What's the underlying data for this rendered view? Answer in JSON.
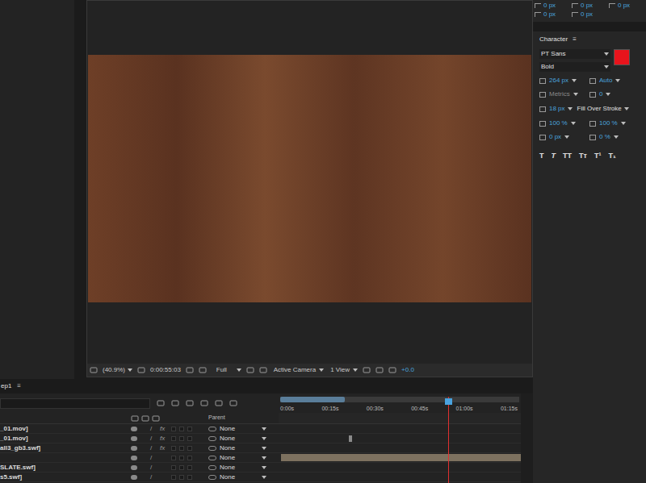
{
  "viewer": {
    "zoom": "(40.9%)",
    "timecode": "0:00:55:03",
    "resolution": "Full",
    "camera": "Active Camera",
    "views": "1 View",
    "exposure": "+0.0"
  },
  "paragraph_spacing": [
    [
      "0 px",
      "0 px",
      "0 px"
    ],
    [
      "0 px",
      "0 px"
    ]
  ],
  "character": {
    "title": "Character",
    "menu": "≡",
    "font": "PT Sans",
    "style": "Bold",
    "size": "264 px",
    "leading": "Auto",
    "kerning": "Metrics",
    "tracking": "0",
    "stroke_width": "18 px",
    "stroke_mode": "Fill Over Stroke",
    "vertical_scale": "100 %",
    "horizontal_scale": "100 %",
    "baseline_shift": "0 px",
    "tsume": "0 %",
    "fill_color": "#e8141c",
    "style_buttons": [
      "T",
      "T",
      "TT",
      "Tт",
      "T¹",
      "T₁"
    ]
  },
  "timeline": {
    "tab": "ep1",
    "tab_menu": "≡",
    "column_header": "Parent",
    "ruler": [
      "0:00s",
      "00:15s",
      "00:30s",
      "00:45s",
      "01:00s",
      "01:15s"
    ],
    "playhead_level": 0.7,
    "work_area_level": 0.27,
    "layers": [
      {
        "name": "_01.mov]",
        "switch": "fx",
        "parent": "None",
        "has_bar": false,
        "marker_level": null
      },
      {
        "name": "_01.mov]",
        "switch": "fx",
        "parent": "None",
        "has_bar": false,
        "marker_level": 0.29
      },
      {
        "name": "all3_gb3.swf]",
        "switch": "fx",
        "parent": "None",
        "has_bar": false,
        "marker_level": null
      },
      {
        "name": "",
        "switch": "",
        "parent": "None",
        "has_bar": true,
        "marker_level": null
      },
      {
        "name": "SLATE.swf]",
        "switch": "",
        "parent": "None",
        "has_bar": false,
        "marker_level": null
      },
      {
        "name": "s5.swf]",
        "switch": "",
        "parent": "None",
        "has_bar": false,
        "marker_level": null
      }
    ]
  }
}
